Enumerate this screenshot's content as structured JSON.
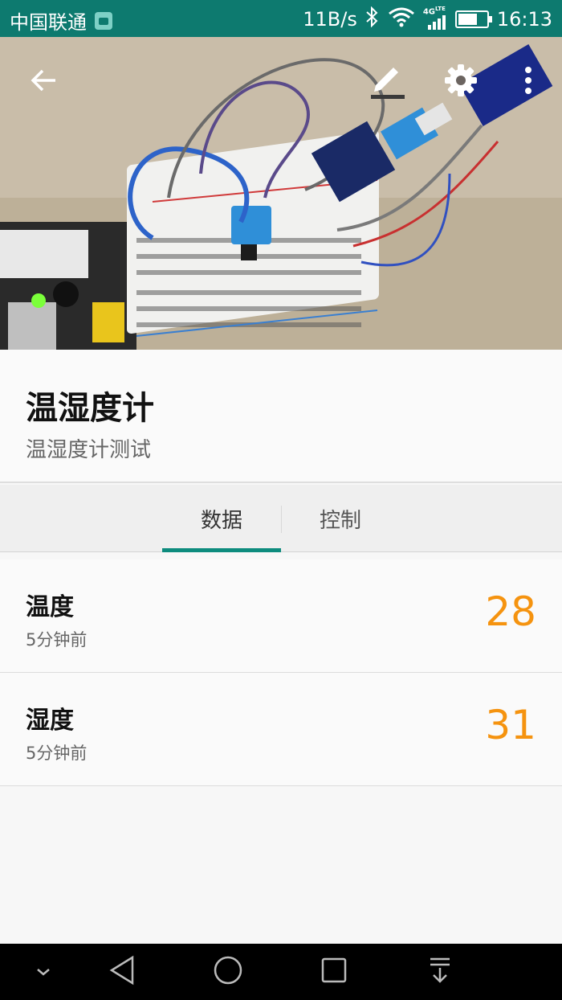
{
  "status_bar": {
    "carrier": "中国联通",
    "net_speed": "11B/s",
    "network_type": "4G LTE",
    "time": "16:13",
    "app_icon": "android-notification-icon",
    "bluetooth_icon": "bluetooth-icon",
    "wifi_icon": "wifi-icon",
    "signal_icon": "cellular-signal-icon",
    "battery_icon": "battery-charging-icon"
  },
  "header": {
    "image": "breadboard-sensor-photo",
    "actions": {
      "back_icon": "arrow-back-icon",
      "edit_icon": "edit-pencil-icon",
      "settings_icon": "gear-icon",
      "more_icon": "more-vert-icon"
    }
  },
  "device": {
    "title": "温湿度计",
    "subtitle": "温湿度计测试"
  },
  "tabs": [
    {
      "label": "数据",
      "selected": true
    },
    {
      "label": "控制",
      "selected": false
    }
  ],
  "data_items": [
    {
      "name": "温度",
      "time": "5分钟前",
      "value": "28"
    },
    {
      "name": "湿度",
      "time": "5分钟前",
      "value": "31"
    }
  ],
  "colors": {
    "status_bar": "#0d7a6f",
    "accent": "#0d8b7d",
    "value": "#f5930f"
  },
  "nav_bar": {
    "collapse_icon": "chevron-down-icon",
    "back_icon": "triangle-back-icon",
    "home_icon": "circle-home-icon",
    "recent_icon": "square-recent-icon",
    "notifications_icon": "pull-down-notifications-icon"
  }
}
